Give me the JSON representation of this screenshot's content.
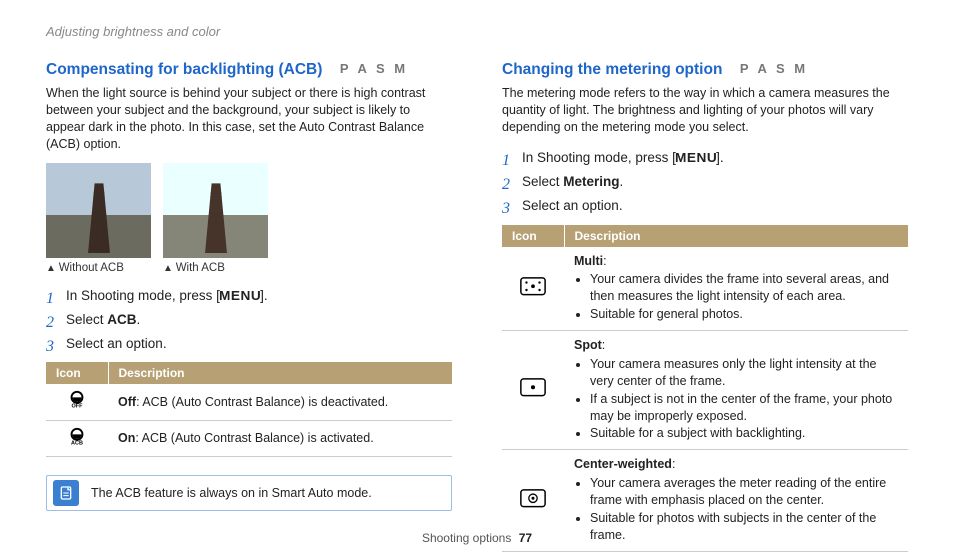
{
  "breadcrumb": "Adjusting brightness and color",
  "footer": {
    "section": "Shooting options",
    "page": "77"
  },
  "modes_label": "P A S M",
  "menu_glyph": "MENU",
  "left": {
    "title": "Compensating for backlighting (ACB)",
    "lead": "When the light source is behind your subject or there is high contrast between your subject and the background, your subject is likely to appear dark in the photo. In this case, set the Auto Contrast Balance (ACB) option.",
    "fig_a": "Without ACB",
    "fig_b": "With ACB",
    "step1_a": "In Shooting mode, press [",
    "step1_b": "].",
    "step2_a": "Select ",
    "step2_b": "ACB",
    "step2_c": ".",
    "step3": "Select an option.",
    "th_icon": "Icon",
    "th_desc": "Description",
    "row1_b": "Off",
    "row1_t": ": ACB (Auto Contrast Balance) is deactivated.",
    "row2_b": "On",
    "row2_t": ": ACB (Auto Contrast Balance) is activated.",
    "note": "The ACB feature is always on in Smart Auto mode."
  },
  "right": {
    "title": "Changing the metering option",
    "lead": "The metering mode refers to the way in which a camera measures the quantity of light. The brightness and lighting of your photos will vary depending on the metering mode you select.",
    "step1_a": "In Shooting mode, press [",
    "step1_b": "].",
    "step2_a": "Select ",
    "step2_b": "Metering",
    "step2_c": ".",
    "step3": "Select an option.",
    "th_icon": "Icon",
    "th_desc": "Description",
    "r1_title": "Multi",
    "r1_b1": "Your camera divides the frame into several areas, and then measures the light intensity of each area.",
    "r1_b2": "Suitable for general photos.",
    "r2_title": "Spot",
    "r2_b1": "Your camera measures only the light intensity at the very center of the frame.",
    "r2_b2": "If a subject is not in the center of the frame, your photo may be improperly exposed.",
    "r2_b3": "Suitable for a subject with backlighting.",
    "r3_title": "Center-weighted",
    "r3_b1": "Your camera averages the meter reading of the entire frame with emphasis placed on the center.",
    "r3_b2": "Suitable for photos with subjects in the center of the frame."
  }
}
